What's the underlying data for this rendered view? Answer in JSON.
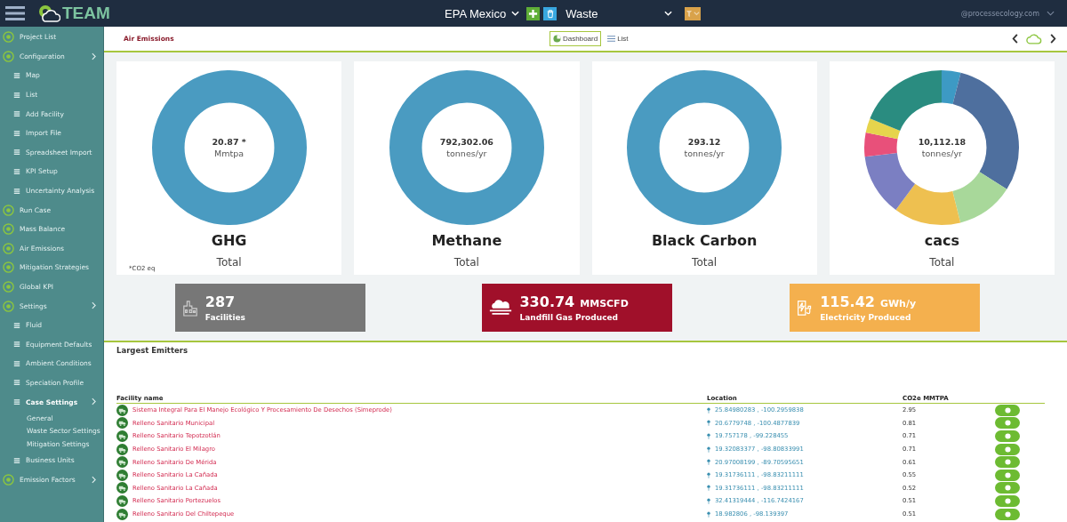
{
  "header": {
    "brand": "TEAM",
    "project": "EPA Mexico",
    "sector": "Waste",
    "user": "@processecology.com"
  },
  "sidebar": {
    "items": [
      {
        "label": "Project List",
        "selected": false,
        "expandable": false
      },
      {
        "label": "Configuration",
        "selected": false,
        "expandable": true,
        "children": [
          {
            "label": "Map",
            "selected": false
          },
          {
            "label": "List",
            "selected": false
          },
          {
            "label": "Add Facility",
            "selected": false
          },
          {
            "label": "Import File",
            "selected": false
          },
          {
            "label": "Spreadsheet Import",
            "selected": false
          },
          {
            "label": "KPI Setup",
            "selected": false
          },
          {
            "label": "Uncertainty Analysis",
            "selected": false
          }
        ]
      },
      {
        "label": "Run Case",
        "selected": false,
        "expandable": false
      },
      {
        "label": "Mass Balance",
        "selected": false,
        "expandable": false
      },
      {
        "label": "Air Emissions",
        "selected": false,
        "expandable": false
      },
      {
        "label": "Mitigation Strategies",
        "selected": false,
        "expandable": false
      },
      {
        "label": "Global KPI",
        "selected": false,
        "expandable": false
      },
      {
        "label": "Settings",
        "selected": false,
        "expandable": true,
        "children": [
          {
            "label": "Fluid",
            "selected": false
          },
          {
            "label": "Equipment Defaults",
            "selected": false
          },
          {
            "label": "Ambient Conditions",
            "selected": false
          },
          {
            "label": "Speciation Profile",
            "selected": false
          },
          {
            "label": "Case Settings",
            "selected": true,
            "expandable": true,
            "children": [
              {
                "label": "General",
                "selected": false
              },
              {
                "label": "Waste Sector Settings",
                "selected": false
              },
              {
                "label": "Mitigation Settings",
                "selected": false
              }
            ]
          },
          {
            "label": "Business Units",
            "selected": false
          }
        ]
      },
      {
        "label": "Emission Factors",
        "selected": false,
        "expandable": true
      }
    ]
  },
  "page_title": "Air Emissions",
  "view_tabs": [
    {
      "label": "Dashboard",
      "selected": true
    },
    {
      "label": "List",
      "selected": false
    }
  ],
  "cards": [
    {
      "kind": "single",
      "value": "20.87 *",
      "unit": "Mmtpa",
      "title": "GHG",
      "subtitle": "Total",
      "footnote": "*CO2 eq"
    },
    {
      "kind": "single",
      "value": "792,302.06",
      "unit": "tonnes/yr",
      "title": "Methane",
      "subtitle": "Total"
    },
    {
      "kind": "single",
      "value": "293.12",
      "unit": "tonnes/yr",
      "title": "Black Carbon",
      "subtitle": "Total"
    },
    {
      "kind": "multi",
      "value": "10,112.18",
      "unit": "tonnes/yr",
      "title": "cacs",
      "subtitle": "Total"
    }
  ],
  "tiles": [
    {
      "kind": "facilities",
      "value": "287",
      "label": "Facilities",
      "color": "#777777"
    },
    {
      "kind": "gas",
      "value": "330.74",
      "unit": "MMSCFD",
      "label": "Landfill Gas Produced",
      "color": "#a0102a"
    },
    {
      "kind": "electricity",
      "value": "115.42",
      "unit": "GWh/y",
      "label": "Electricity Produced",
      "color": "#f4b04e"
    }
  ],
  "emitters": {
    "title": "Largest Emitters",
    "columns": [
      "Facility name",
      "Location",
      "CO2e MMTPA"
    ],
    "rows": [
      {
        "name": "Sistema Integral Para El Manejo Ecológico Y Procesamiento De Desechos (Simeprode)",
        "location": "25.84980283 , -100.2959838",
        "value": "2.95"
      },
      {
        "name": "Relleno Sanitario Municipal",
        "location": "20.6779748 , -100.4877839",
        "value": "0.81"
      },
      {
        "name": "Relleno Sanitario Tepotzotlán",
        "location": "19.757178 , -99.228455",
        "value": "0.71"
      },
      {
        "name": "Relleno Sanitario El Milagro",
        "location": "19.32083377 , -98.80833991",
        "value": "0.71"
      },
      {
        "name": "Relleno Sanitario De Mérida",
        "location": "20.97008199 , -89.70595651",
        "value": "0.61"
      },
      {
        "name": "Relleno Sanitario La Cañada",
        "location": "19.31736111 , -98.83211111",
        "value": "0.55"
      },
      {
        "name": "Relleno Sanitario La Cañada",
        "location": "19.31736111 , -98.83211111",
        "value": "0.52"
      },
      {
        "name": "Relleno Sanitario Portezuelos",
        "location": "32.41319444 , -116.7424167",
        "value": "0.51"
      },
      {
        "name": "Relleno Sanitario Del Chiltepeque",
        "location": "18.982806 , -98.139397",
        "value": "0.51"
      }
    ]
  }
}
